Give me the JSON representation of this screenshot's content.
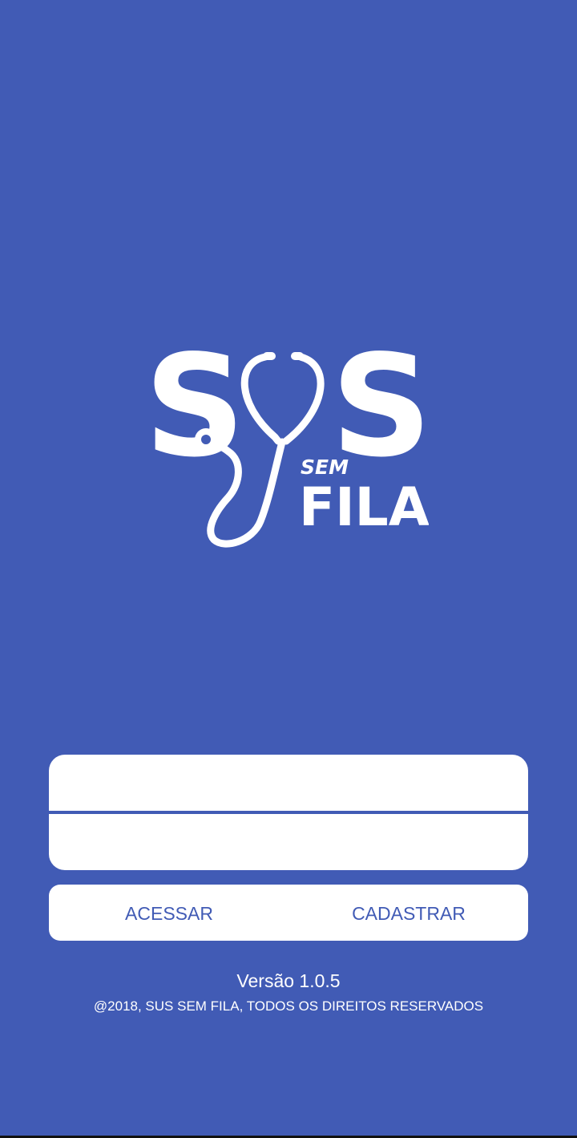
{
  "app": {
    "logo_text": "SUS SEM FILA"
  },
  "login": {
    "field1_placeholder": "",
    "field2_placeholder": "",
    "access_label": "ACESSAR",
    "register_label": "CADASTRAR"
  },
  "footer": {
    "version": "Versão 1.0.5",
    "copyright": "@2018, SUS SEM FILA, TODOS OS DIREITOS RESERVADOS"
  },
  "colors": {
    "background": "#415bb5",
    "panel": "#ffffff",
    "accent_text": "#415bb5"
  },
  "icons": [
    "stethoscope-icon"
  ]
}
